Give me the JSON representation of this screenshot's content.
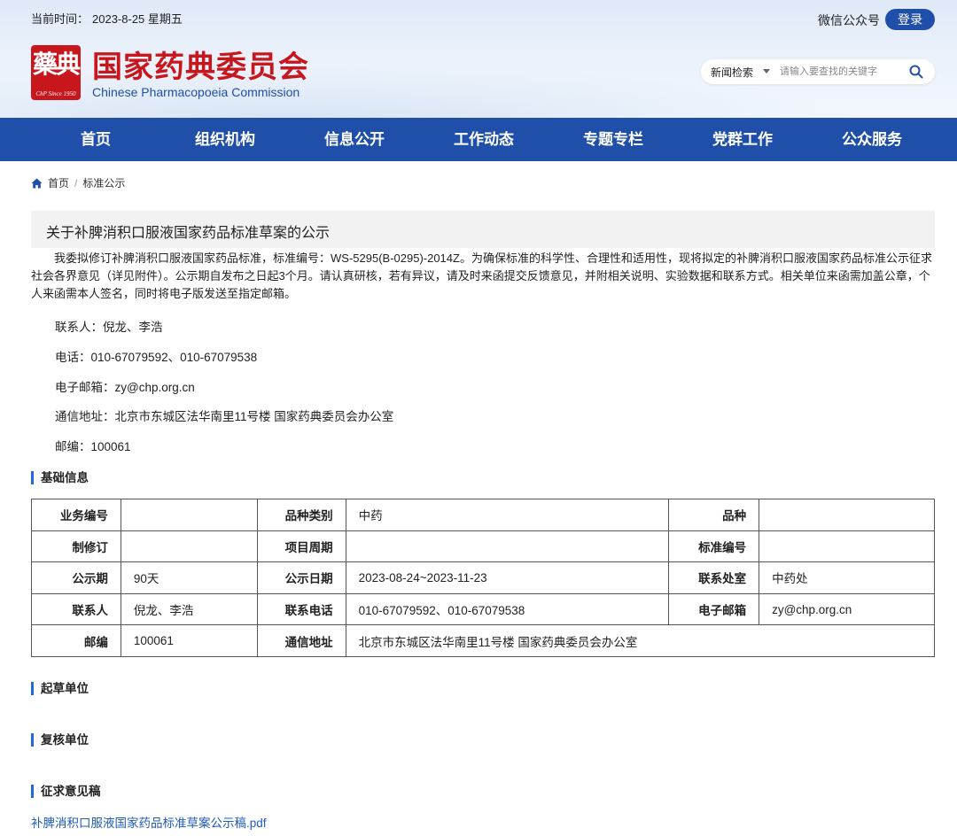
{
  "header": {
    "date_label": "当前时间：",
    "date_value": "2023-8-25 星期五",
    "wechat": "微信公众号",
    "login": "登录",
    "logo_cn": "国家药典委员会",
    "logo_en": "Chinese Pharmacopoeia Commission",
    "seal_since": "ChP Since 1950",
    "search_category": "新闻检索",
    "search_placeholder": "请输入要查找的关键字"
  },
  "nav": [
    "首页",
    "组织机构",
    "信息公开",
    "工作动态",
    "专题专栏",
    "党群工作",
    "公众服务"
  ],
  "breadcrumb": {
    "home": "首页",
    "sep": "/",
    "current": "标准公示"
  },
  "article": {
    "title": "关于补脾消积口服液国家药品标准草案的公示",
    "body": "我委拟修订补脾消积口服液国家药品标准，标准编号：WS-5295(B-0295)-2014Z。为确保标准的科学性、合理性和适用性，现将拟定的补脾消积口服液国家药品标准公示征求社会各界意见（详见附件）。公示期自发布之日起3个月。请认真研核，若有异议，请及时来函提交反馈意见，并附相关说明、实验数据和联系方式。相关单位来函需加盖公章，个人来函需本人签名，同时将电子版发送至指定邮箱。",
    "contact": "联系人：倪龙、李浩",
    "phone": "电话：010-67079592、010-67079538",
    "email": "电子邮箱：zy@chp.org.cn",
    "address": "通信地址：北京市东城区法华南里11号楼 国家药典委员会办公室",
    "postcode": "邮编：100061"
  },
  "sections": {
    "basic": "基础信息",
    "draft_unit": "起草单位",
    "review_unit": "复核单位",
    "comment_draft": "征求意见稿"
  },
  "table": {
    "r1": {
      "l1": "业务编号",
      "v1": "",
      "l2": "品种类别",
      "v2": "中药",
      "l3": "品种",
      "v3": ""
    },
    "r2": {
      "l1": "制修订",
      "v1": "",
      "l2": "项目周期",
      "v2": "",
      "l3": "标准编号",
      "v3": ""
    },
    "r3": {
      "l1": "公示期",
      "v1": "90天",
      "l2": "公示日期",
      "v2": "2023-08-24~2023-11-23",
      "l3": "联系处室",
      "v3": "中药处"
    },
    "r4": {
      "l1": "联系人",
      "v1": "倪龙、李浩",
      "l2": "联系电话",
      "v2": "010-67079592、010-67079538",
      "l3": "电子邮箱",
      "v3": "zy@chp.org.cn"
    },
    "r5": {
      "l1": "邮编",
      "v1": "100061",
      "l2": "通信地址",
      "v2": "北京市东城区法华南里11号楼 国家药典委员会办公室"
    }
  },
  "attachment": "补脾消积口服液国家药品标准草案公示稿.pdf",
  "colors": {
    "nav": "#1f4fa8",
    "seal": "#c8161d",
    "link": "#1f5bb8",
    "section_bar": "#1f6ad8"
  }
}
